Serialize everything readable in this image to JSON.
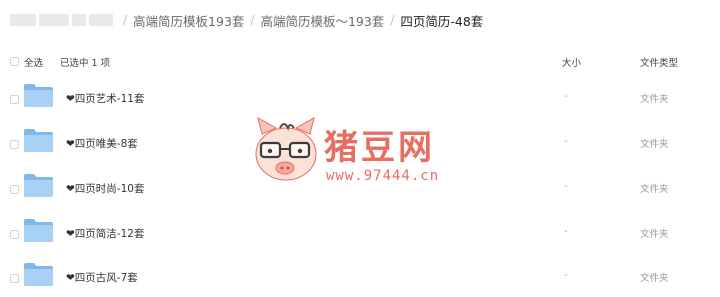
{
  "breadcrumb": {
    "items": [
      {
        "label": "高端简历模板193套"
      },
      {
        "label": "高端简历模板～193套"
      },
      {
        "label": "四页简历-48套"
      }
    ],
    "separator": "/"
  },
  "list_header": {
    "select_all": "全选",
    "selected": "已选中 1 项",
    "size": "大小",
    "type": "文件类型"
  },
  "rows": [
    {
      "name": "❤四页艺术-11套",
      "size": "-",
      "type": "文件夹"
    },
    {
      "name": "❤四页唯美-8套",
      "size": "-",
      "type": "文件夹"
    },
    {
      "name": "❤四页时尚-10套",
      "size": "-",
      "type": "文件夹"
    },
    {
      "name": "❤四页简洁-12套",
      "size": "-",
      "type": "文件夹"
    },
    {
      "name": "❤四页古风-7套",
      "size": "-",
      "type": "文件夹"
    }
  ],
  "watermark": {
    "brand": "猪豆网",
    "url": "www.97444.cn"
  },
  "colors": {
    "folder_back": "#7fb8ea",
    "folder_front": "#a9d1f5",
    "watermark": "#e86d63"
  }
}
